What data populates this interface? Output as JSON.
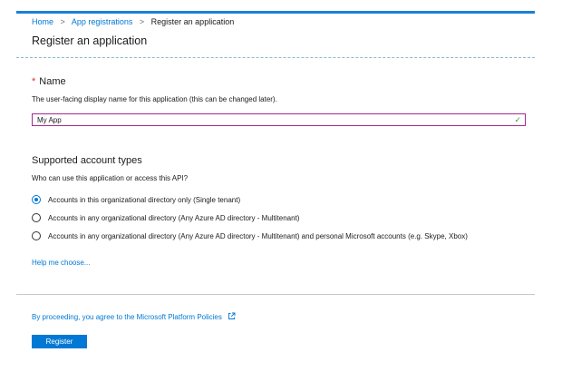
{
  "breadcrumb": {
    "home": "Home",
    "app_registrations": "App registrations",
    "current": "Register an application",
    "separator": ">"
  },
  "page_title": "Register an application",
  "name_section": {
    "required_marker": "*",
    "label": "Name",
    "helper": "The user-facing display name for this application (this can be changed later).",
    "input_value": "My App",
    "valid_icon": "check-icon"
  },
  "account_types": {
    "heading": "Supported account types",
    "question": "Who can use this application or access this API?",
    "options": [
      {
        "label": "Accounts in this organizational directory only (Single tenant)",
        "selected": true
      },
      {
        "label": "Accounts in any organizational directory (Any Azure AD directory - Multitenant)",
        "selected": false
      },
      {
        "label": "Accounts in any organizational directory (Any Azure AD directory - Multitenant) and personal Microsoft accounts (e.g. Skype, Xbox)",
        "selected": false
      }
    ],
    "help_link": "Help me choose..."
  },
  "footer": {
    "policy_text": "By proceeding, you agree to the Microsoft Platform Policies",
    "policy_icon": "external-link-icon",
    "register_label": "Register"
  },
  "colors": {
    "accent": "#0078d4",
    "input_border": "#a3288f",
    "valid": "#3b9e3b",
    "required": "#d13438"
  }
}
